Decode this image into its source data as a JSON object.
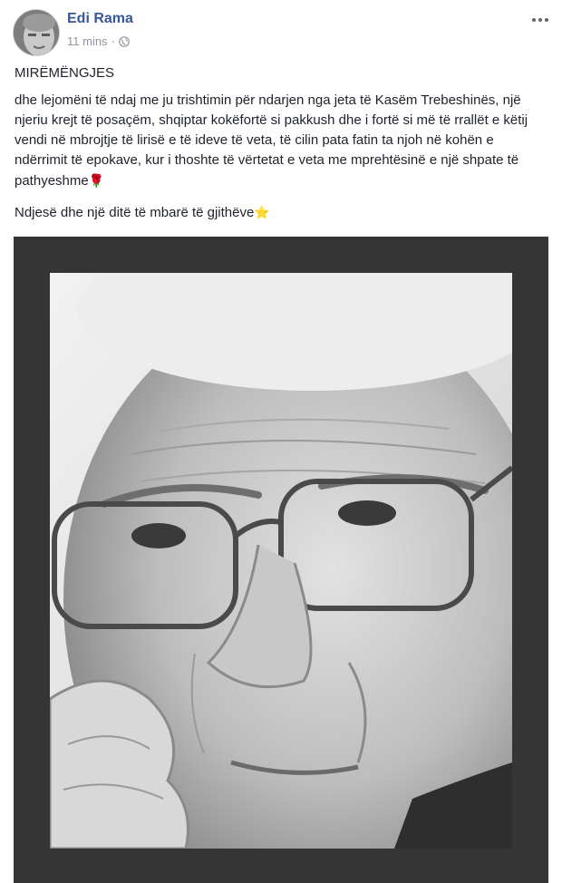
{
  "post": {
    "author": "Edi Rama",
    "time": "11 mins",
    "separator": "·",
    "privacy_icon": "globe-icon",
    "more_icon": "ellipsis-icon",
    "greeting": "MIRËMËNGJES",
    "paragraph": "dhe lejomëni të ndaj me ju trishtimin për ndarjen nga jeta të Kasëm Trebeshinës, një njeriu krejt të posaçëm, shqiptar kokëfortë si pakkush dhe i fortë si më të rrallët e këtij vendi në mbrojtje të lirisë e të ideve të veta, të cilin pata fatin ta njoh në kohën e ndërrimit të epokave, kur i thoshte të vërtetat e veta me mprehtësinë e një shpate të pathyeshme",
    "paragraph_emoji": "🌹",
    "closing": "Ndjesë dhe një ditë të mbarë të gjithëve",
    "closing_emoji": "⭐"
  },
  "colors": {
    "author": "#365899",
    "meta": "#90949c",
    "text": "#1d2129",
    "photo_frame": "#353535"
  }
}
